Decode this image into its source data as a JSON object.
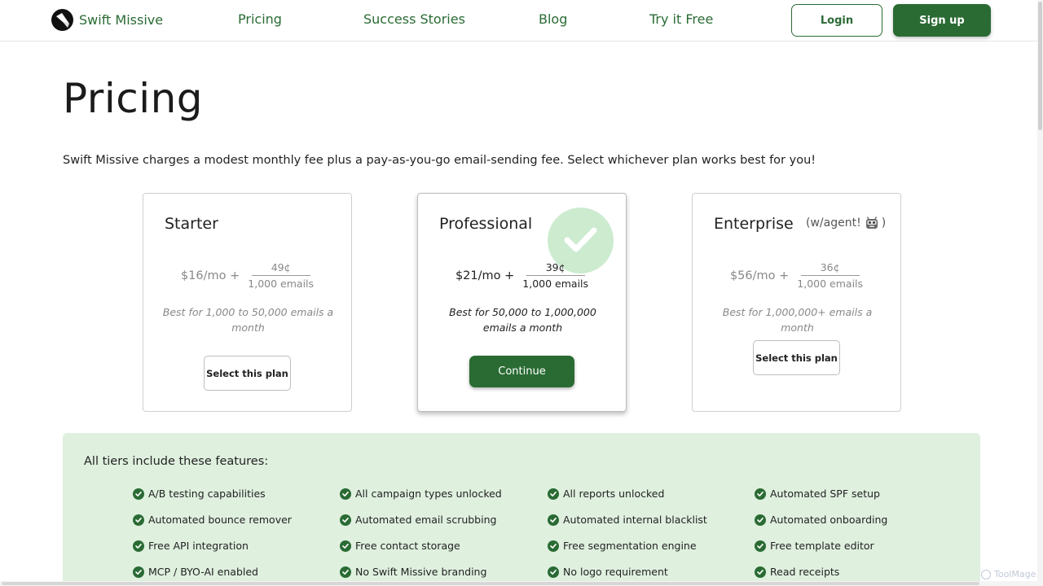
{
  "nav": {
    "brand": "Swift Missive",
    "links": [
      "Pricing",
      "Success Stories",
      "Blog",
      "Try it Free"
    ],
    "login_label": "Login",
    "signup_label": "Sign up"
  },
  "header": {
    "title": "Pricing",
    "description": "Swift Missive charges a modest monthly fee plus a pay-as-you-go email-sending fee. Select whichever plan works best for you!"
  },
  "plans": [
    {
      "name": "Starter",
      "base_price": "$16/mo +",
      "rate": "49¢",
      "rate_unit": "1,000 emails",
      "best_for": "Best for 1,000 to 50,000 emails a month",
      "action_label": "Select this plan",
      "selected": false
    },
    {
      "name": "Professional",
      "base_price": "$21/mo +",
      "rate": "39¢",
      "rate_unit": "1,000 emails",
      "best_for": "Best for 50,000 to 1,000,000 emails a month",
      "action_label": "Continue",
      "selected": true
    },
    {
      "name": "Enterprise",
      "extra_open": "(w/agent!",
      "extra_close": ")",
      "agent_icon": "robot-face-icon",
      "base_price": "$56/mo +",
      "rate": "36¢",
      "rate_unit": "1,000 emails",
      "best_for": "Best for 1,000,000+ emails a month",
      "action_label": "Select this plan",
      "selected": false
    }
  ],
  "features": {
    "title": "All tiers include these features:",
    "items": [
      "A/B testing capabilities",
      "All campaign types unlocked",
      "All reports unlocked",
      "Automated SPF setup",
      "Automated bounce remover",
      "Automated email scrubbing",
      "Automated internal blacklist",
      "Automated onboarding",
      "Free API integration",
      "Free contact storage",
      "Free segmentation engine",
      "Free template editor",
      "MCP / BYO-AI enabled",
      "No Swift Missive branding",
      "No logo requirement",
      "Read receipts"
    ]
  },
  "watermark": "ToolMage",
  "colors": {
    "brand_green": "#2a6b34",
    "feature_bg": "#dff0df",
    "check_badge": "#aadeaf"
  }
}
